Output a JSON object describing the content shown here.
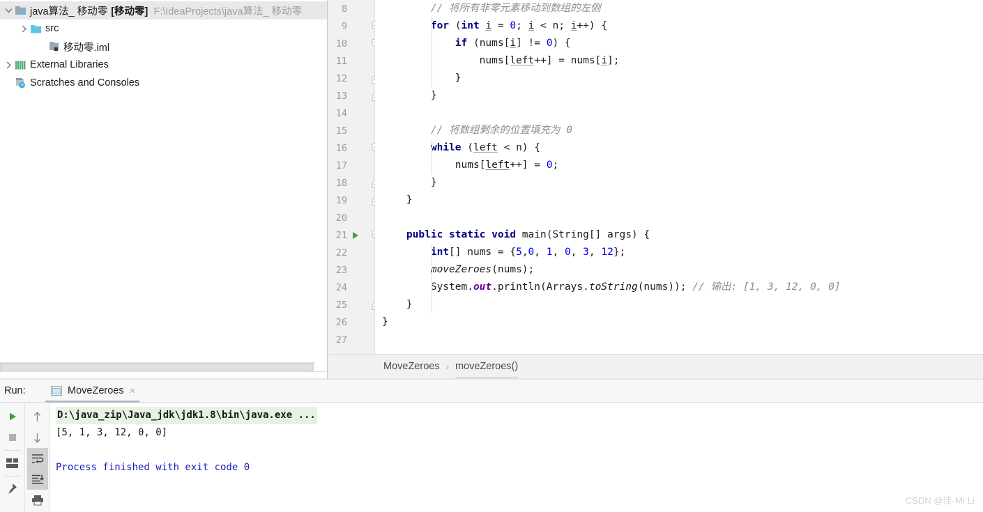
{
  "project_panel": {
    "name": "project-tool-window",
    "tree": [
      {
        "depth": 0,
        "icon": "project-module-icon",
        "arrow": "expanded",
        "label": "java算法_ 移动零",
        "bold": "[移动零]",
        "path": "F:\\IdeaProjects\\java算法_ 移动零",
        "selected": true
      },
      {
        "depth": 1,
        "icon": "folder-icon",
        "arrow": "collapsed",
        "label": "src",
        "bold": "",
        "path": "",
        "selected": false
      },
      {
        "depth": 2,
        "icon": "iml-file-icon",
        "arrow": "none",
        "label": "移动零.iml",
        "bold": "",
        "path": "",
        "selected": false
      },
      {
        "depth": 0,
        "icon": "external-libraries-icon",
        "arrow": "collapsed",
        "label": "External Libraries",
        "bold": "",
        "path": "",
        "selected": false
      },
      {
        "depth": 0,
        "icon": "scratches-icon",
        "arrow": "none",
        "label": "Scratches and Consoles",
        "bold": "",
        "path": "",
        "selected": false
      }
    ]
  },
  "editor": {
    "name": "code-editor",
    "first_line": 8,
    "lines": [
      {
        "num": 8,
        "fold": "none",
        "run": false,
        "tokens": [
          {
            "t": "        ",
            "c": "plain"
          },
          {
            "t": "// 将所有非零元素移动到数组的左侧",
            "c": "cmt"
          }
        ]
      },
      {
        "num": 9,
        "fold": "open",
        "run": false,
        "tokens": [
          {
            "t": "        ",
            "c": "plain"
          },
          {
            "t": "for",
            "c": "kw"
          },
          {
            "t": " (",
            "c": "plain"
          },
          {
            "t": "int",
            "c": "kw"
          },
          {
            "t": " ",
            "c": "plain"
          },
          {
            "t": "i",
            "c": "var"
          },
          {
            "t": " = ",
            "c": "plain"
          },
          {
            "t": "0",
            "c": "num"
          },
          {
            "t": "; ",
            "c": "plain"
          },
          {
            "t": "i",
            "c": "var"
          },
          {
            "t": " < n; ",
            "c": "plain"
          },
          {
            "t": "i",
            "c": "var"
          },
          {
            "t": "++) {",
            "c": "plain"
          }
        ]
      },
      {
        "num": 10,
        "fold": "open",
        "run": false,
        "tokens": [
          {
            "t": "            ",
            "c": "plain"
          },
          {
            "t": "if",
            "c": "kw"
          },
          {
            "t": " (nums[",
            "c": "plain"
          },
          {
            "t": "i",
            "c": "var"
          },
          {
            "t": "] != ",
            "c": "plain"
          },
          {
            "t": "0",
            "c": "num"
          },
          {
            "t": ") {",
            "c": "plain"
          }
        ]
      },
      {
        "num": 11,
        "fold": "none",
        "run": false,
        "tokens": [
          {
            "t": "                nums[",
            "c": "plain"
          },
          {
            "t": "left",
            "c": "var"
          },
          {
            "t": "++] = nums[",
            "c": "plain"
          },
          {
            "t": "i",
            "c": "var"
          },
          {
            "t": "];",
            "c": "plain"
          }
        ]
      },
      {
        "num": 12,
        "fold": "close",
        "run": false,
        "tokens": [
          {
            "t": "            }",
            "c": "plain"
          }
        ]
      },
      {
        "num": 13,
        "fold": "close",
        "run": false,
        "tokens": [
          {
            "t": "        }",
            "c": "plain"
          }
        ]
      },
      {
        "num": 14,
        "fold": "none",
        "run": false,
        "tokens": []
      },
      {
        "num": 15,
        "fold": "none",
        "run": false,
        "tokens": [
          {
            "t": "        ",
            "c": "plain"
          },
          {
            "t": "// 将数组剩余的位置填充为 0",
            "c": "cmt"
          }
        ]
      },
      {
        "num": 16,
        "fold": "open",
        "run": false,
        "tokens": [
          {
            "t": "        ",
            "c": "plain"
          },
          {
            "t": "while",
            "c": "kw"
          },
          {
            "t": " (",
            "c": "plain"
          },
          {
            "t": "left",
            "c": "var"
          },
          {
            "t": " < n) {",
            "c": "plain"
          }
        ]
      },
      {
        "num": 17,
        "fold": "none",
        "run": false,
        "tokens": [
          {
            "t": "            nums[",
            "c": "plain"
          },
          {
            "t": "left",
            "c": "var"
          },
          {
            "t": "++] = ",
            "c": "plain"
          },
          {
            "t": "0",
            "c": "num"
          },
          {
            "t": ";",
            "c": "plain"
          }
        ]
      },
      {
        "num": 18,
        "fold": "close",
        "run": false,
        "tokens": [
          {
            "t": "        }",
            "c": "plain"
          }
        ]
      },
      {
        "num": 19,
        "fold": "close",
        "run": false,
        "tokens": [
          {
            "t": "    }",
            "c": "plain"
          }
        ]
      },
      {
        "num": 20,
        "fold": "none",
        "run": false,
        "tokens": []
      },
      {
        "num": 21,
        "fold": "open",
        "run": true,
        "tokens": [
          {
            "t": "    ",
            "c": "plain"
          },
          {
            "t": "public static void",
            "c": "kw"
          },
          {
            "t": " main(String[] args) {",
            "c": "plain"
          }
        ]
      },
      {
        "num": 22,
        "fold": "none",
        "run": false,
        "tokens": [
          {
            "t": "        ",
            "c": "plain"
          },
          {
            "t": "int",
            "c": "kw"
          },
          {
            "t": "[] nums = {",
            "c": "plain"
          },
          {
            "t": "5",
            "c": "num"
          },
          {
            "t": ",",
            "c": "plain"
          },
          {
            "t": "0",
            "c": "num"
          },
          {
            "t": ", ",
            "c": "plain"
          },
          {
            "t": "1",
            "c": "num"
          },
          {
            "t": ", ",
            "c": "plain"
          },
          {
            "t": "0",
            "c": "num"
          },
          {
            "t": ", ",
            "c": "plain"
          },
          {
            "t": "3",
            "c": "num"
          },
          {
            "t": ", ",
            "c": "plain"
          },
          {
            "t": "12",
            "c": "num"
          },
          {
            "t": "};",
            "c": "plain"
          }
        ]
      },
      {
        "num": 23,
        "fold": "none",
        "run": false,
        "tokens": [
          {
            "t": "        ",
            "c": "plain"
          },
          {
            "t": "moveZeroes",
            "c": "mth"
          },
          {
            "t": "(nums);",
            "c": "plain"
          }
        ]
      },
      {
        "num": 24,
        "fold": "none",
        "run": false,
        "tokens": [
          {
            "t": "        System.",
            "c": "plain"
          },
          {
            "t": "out",
            "c": "stc"
          },
          {
            "t": ".println(Arrays.",
            "c": "plain"
          },
          {
            "t": "toString",
            "c": "mth"
          },
          {
            "t": "(nums)); ",
            "c": "plain"
          },
          {
            "t": "// 输出: [1, 3, 12, 0, 0]",
            "c": "cmt"
          }
        ]
      },
      {
        "num": 25,
        "fold": "close",
        "run": false,
        "tokens": [
          {
            "t": "    }",
            "c": "plain"
          }
        ]
      },
      {
        "num": 26,
        "fold": "none",
        "run": false,
        "tokens": [
          {
            "t": "}",
            "c": "plain"
          }
        ]
      },
      {
        "num": 27,
        "fold": "none",
        "run": false,
        "tokens": []
      }
    ],
    "breadcrumb": {
      "class": "MoveZeroes",
      "separator": "›",
      "method": "moveZeroes()"
    }
  },
  "run_panel": {
    "name": "run-tool-window",
    "title": "Run:",
    "tab": {
      "label": "MoveZeroes",
      "icon": "console-window-icon",
      "close": "×"
    },
    "toolbar_left": [
      {
        "icon": "run-play-icon",
        "active": false
      },
      {
        "icon": "stop-icon",
        "active": false
      },
      {
        "icon": "layout-restore-icon",
        "active": false
      },
      {
        "icon": "pin-icon",
        "active": false
      }
    ],
    "toolbar_right": [
      {
        "icon": "arrow-up-icon",
        "active": false
      },
      {
        "icon": "arrow-down-icon",
        "active": false
      },
      {
        "icon": "soft-wrap-icon",
        "active": true
      },
      {
        "icon": "scroll-to-end-icon",
        "active": true
      },
      {
        "icon": "print-icon",
        "active": false
      }
    ],
    "output": [
      {
        "text": "D:\\java_zip\\Java_jdk\\jdk1.8\\bin\\java.exe ...",
        "style": "command"
      },
      {
        "text": "[5, 1, 3, 12, 0, 0]",
        "style": "stdout"
      },
      {
        "text": "",
        "style": "stdout"
      },
      {
        "text": "Process finished with exit code 0",
        "style": "finished"
      }
    ]
  },
  "watermark": {
    "text": "CSDN @佳-Mr.Li"
  },
  "colors": {
    "keyword": "#000080",
    "number": "#0000ee",
    "comment": "#8c8c8c",
    "static_field": "#660099",
    "run_green": "#3f9f3f",
    "command_bg": "#e6f3e2",
    "finished_blue": "#1a1ac0",
    "selection": "#e8e8e8",
    "gutter_bg": "#f1f1f1"
  }
}
